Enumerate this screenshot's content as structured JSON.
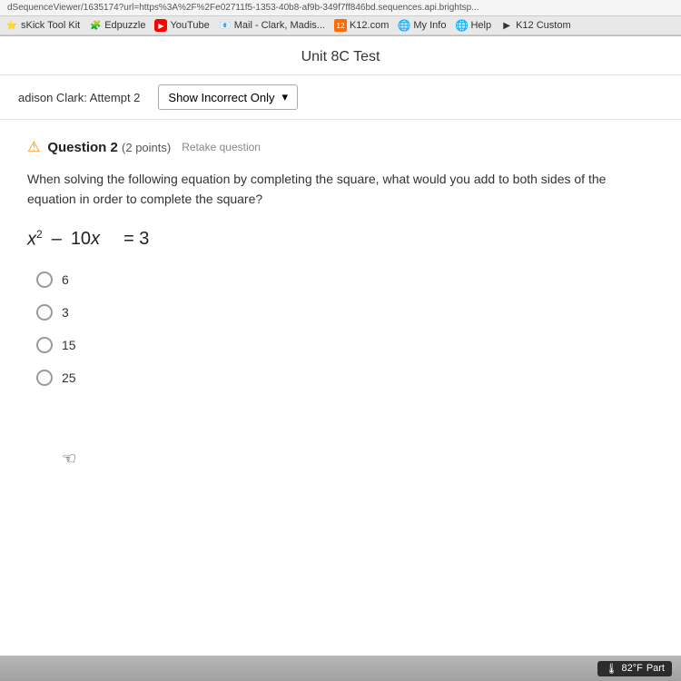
{
  "browser": {
    "url": "dSequenceViewer/1635174?url=https%3A%2F%2Fe02711f5-1353-40b8-af9b-349f7ff846bd.sequences.api.brightsp...",
    "bookmarks": [
      {
        "label": "sKick Tool Kit",
        "icon": "star",
        "type": "generic"
      },
      {
        "label": "Edpuzzle",
        "icon": "puzzle",
        "type": "edpuzzle"
      },
      {
        "label": "YouTube",
        "icon": "play",
        "type": "youtube"
      },
      {
        "label": "Mail - Clark, Madis...",
        "icon": "mail",
        "type": "mail"
      },
      {
        "label": "K12.com",
        "icon": "k12",
        "type": "k12"
      },
      {
        "label": "My Info",
        "icon": "globe",
        "type": "globe"
      },
      {
        "label": "Help",
        "icon": "globe",
        "type": "globe"
      },
      {
        "label": "K12 Custom",
        "icon": "arrow",
        "type": "generic"
      }
    ]
  },
  "page": {
    "title": "Unit 8C Test",
    "student_label": "adison Clark: Attempt 2",
    "filter_label": "Show Incorrect Only",
    "filter_chevron": "▾"
  },
  "question": {
    "number": "Question 2",
    "points": "(2 points)",
    "retake": "Retake question",
    "text": "When solving the following equation by completing the square, what would you add to both sides of the equation in order to complete the square?",
    "equation": "x² – 10x   = 3",
    "options": [
      {
        "value": "6",
        "id": "opt1"
      },
      {
        "value": "3",
        "id": "opt2"
      },
      {
        "value": "15",
        "id": "opt3"
      },
      {
        "value": "25",
        "id": "opt4"
      }
    ]
  },
  "statusbar": {
    "weather": "82°F",
    "status": "Part"
  }
}
